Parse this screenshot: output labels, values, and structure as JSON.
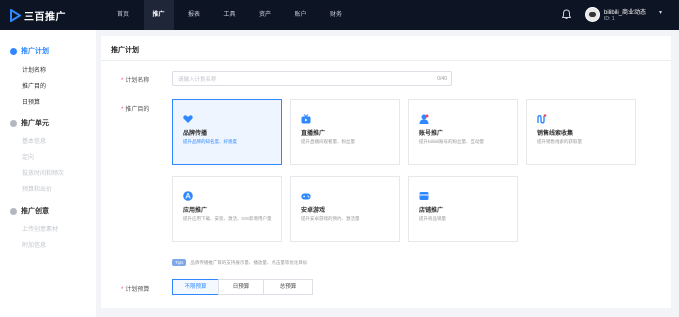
{
  "app": {
    "logo_text": "三百推广"
  },
  "topnav": {
    "items": [
      {
        "label": "首页",
        "active": false
      },
      {
        "label": "推广",
        "active": true
      },
      {
        "label": "报表",
        "active": false
      },
      {
        "label": "工具",
        "active": false
      },
      {
        "label": "资产",
        "active": false
      },
      {
        "label": "账户",
        "active": false
      },
      {
        "label": "财务",
        "active": false
      }
    ]
  },
  "user": {
    "name": "bilibili_商业动态",
    "id": "ID: 1"
  },
  "sidebar": {
    "sections": [
      {
        "title": "推广计划",
        "active": true,
        "items": [
          "计划名称",
          "推广目的",
          "日预算"
        ]
      },
      {
        "title": "推广单元",
        "active": false,
        "items": [
          "基本信息",
          "定向",
          "投放时间和频次",
          "预算和出价"
        ]
      },
      {
        "title": "推广创意",
        "active": false,
        "items": [
          "上传创意素材",
          "附加信息"
        ]
      }
    ]
  },
  "main": {
    "title": "推广计划",
    "plan_name": {
      "label": "计划名称",
      "placeholder": "请输入计划名称",
      "counter": "0/40"
    },
    "purpose": {
      "label": "推广目的",
      "cards": [
        {
          "title": "品牌传播",
          "desc": "提升品牌的知名度、好感度",
          "icon": "heart-icon",
          "selected": true
        },
        {
          "title": "直播推广",
          "desc": "提升直播间观看量、粉丝量",
          "icon": "tv-icon",
          "selected": false
        },
        {
          "title": "账号推广",
          "desc": "提升bilibili账号的粉丝量、互动量",
          "icon": "user-icon",
          "selected": false
        },
        {
          "title": "销售线索收集",
          "desc": "提升销售线索的获取量",
          "icon": "funnel-icon",
          "selected": false
        },
        {
          "title": "应用推广",
          "desc": "提升应用下载、安装、激活、iOS新增用户量",
          "icon": "app-store-icon",
          "selected": false
        },
        {
          "title": "安卓游戏",
          "desc": "提升安卓游戏的预约、激活量",
          "icon": "gamepad-icon",
          "selected": false
        },
        {
          "title": "店铺推广",
          "desc": "提升商品销量",
          "icon": "shop-icon",
          "selected": false
        }
      ]
    },
    "tip": {
      "badge": "Tips",
      "text": "品牌传播推广目的支持展示量、播放量、点击量等优化目标"
    },
    "budget": {
      "label": "计划预算",
      "options": [
        "不限预算",
        "日预算",
        "总预算"
      ],
      "selected": 0
    }
  },
  "colors": {
    "accent": "#2f88ff",
    "nav_bg": "#0d1424",
    "required": "#f5455c"
  }
}
